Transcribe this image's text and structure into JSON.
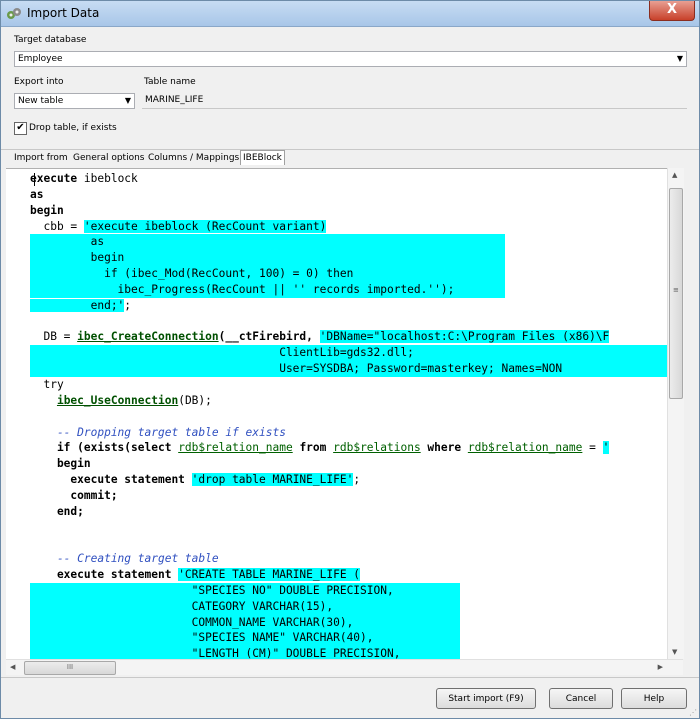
{
  "window": {
    "title": "Import Data",
    "close_label": "X"
  },
  "target_db": {
    "label": "Target database",
    "value": "Employee"
  },
  "export_into": {
    "label": "Export into",
    "value": "New table"
  },
  "table_name": {
    "label": "Table name",
    "value": "MARINE_LIFE"
  },
  "drop_table": {
    "label": "Drop table, if exists",
    "checked": true,
    "mark": "✔"
  },
  "tabs": [
    {
      "label": "Import from"
    },
    {
      "label": "General options"
    },
    {
      "label": "Columns / Mappings"
    },
    {
      "label": "IBEBlock"
    }
  ],
  "code": {
    "l1_kw": "execute",
    "l1_rest": " ibeblock",
    "l2": "as",
    "l3": "begin",
    "l4_pre": "  cbb = ",
    "l4_str": "'execute ibeblock (RecCount variant)",
    "l5": "         as",
    "l6": "         begin",
    "l7": "           if (ibec_Mod(RecCount, 100) = 0) then",
    "l8": "             ibec_Progress(RecCount || '' records imported.'');",
    "l9": "         end;'",
    "l9_end": ";",
    "l11_pre": "  DB = ",
    "l11_fn": "ibec_CreateConnection",
    "l11_mid": "(__ctFirebird, ",
    "l11_str": "'DBName=\"localhost:C:\\Program Files (x86)\\F",
    "l12": "                                     ClientLib=gds32.dll;",
    "l13": "                                     User=SYSDBA; Password=masterkey; Names=NON",
    "l14": "  try",
    "l15_pre": "    ",
    "l15_fn": "ibec_UseConnection",
    "l15_rest": "(DB);",
    "l17": "    -- Dropping target table if exists",
    "l18_a": "    if (exists(select ",
    "l18_b": "rdb$relation_name",
    "l18_c": " from ",
    "l18_d": "rdb$relations",
    "l18_e": " where ",
    "l18_f": "rdb$relation_name",
    "l18_g": " = ",
    "l18_h": "'",
    "l19": "    begin",
    "l20_pre": "      execute statement ",
    "l20_str": "'drop table MARINE_LIFE'",
    "l20_end": ";",
    "l21": "      commit;",
    "l22": "    end;",
    "l25": "    -- Creating target table",
    "l26_pre": "    execute statement ",
    "l26_str": "'CREATE TABLE MARINE_LIFE (",
    "l27": "                        \"SPECIES NO\" DOUBLE PRECISION,",
    "l28": "                        CATEGORY VARCHAR(15),",
    "l29": "                        COMMON_NAME VARCHAR(30),",
    "l30": "                        \"SPECIES NAME\" VARCHAR(40),",
    "l31": "                        \"LENGTH (CM)\" DOUBLE PRECISION,"
  },
  "buttons": {
    "start": "Start import (F9)",
    "cancel": "Cancel",
    "help": "Help"
  },
  "icons": {
    "dropdown": "▼",
    "scroll_up": "▲",
    "scroll_down": "▼",
    "scroll_left": "◀",
    "scroll_right": "▶",
    "thumb_grip": "III",
    "vthumb_grip": "≡",
    "size_grip": "⋰"
  }
}
